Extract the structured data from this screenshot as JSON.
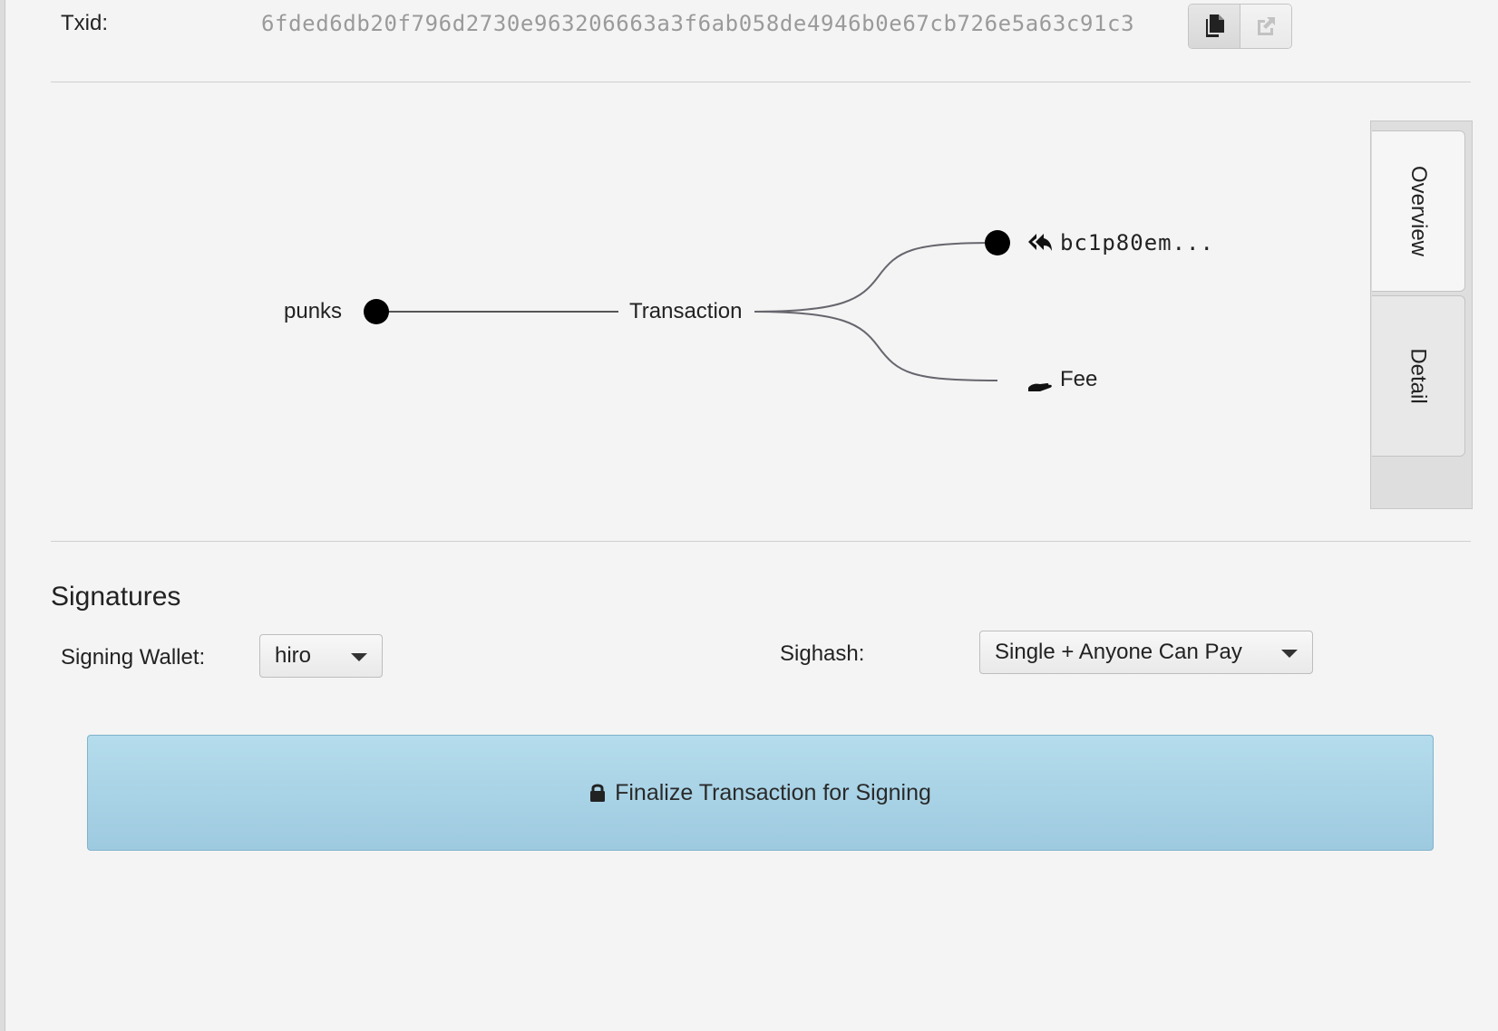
{
  "txid": {
    "label": "Txid:",
    "value": "6fded6db20f796d2730e963206663a3f6ab058de4946b0e67cb726e5a63c91c3"
  },
  "graph": {
    "input_label": "punks",
    "center_label": "Transaction",
    "output_address": "bc1p80em...",
    "fee_label": "Fee"
  },
  "side_tabs": {
    "overview": "Overview",
    "detail": "Detail"
  },
  "signatures": {
    "title": "Signatures",
    "wallet_label": "Signing Wallet:",
    "wallet_value": "hiro",
    "sighash_label": "Sighash:",
    "sighash_value": "Single + Anyone Can Pay",
    "finalize_label": "Finalize Transaction for Signing"
  },
  "icons": {
    "copy": "copy-icon",
    "open": "external-link-icon",
    "output": "reply-all-icon",
    "fee": "hand-icon",
    "lock": "lock-icon"
  }
}
